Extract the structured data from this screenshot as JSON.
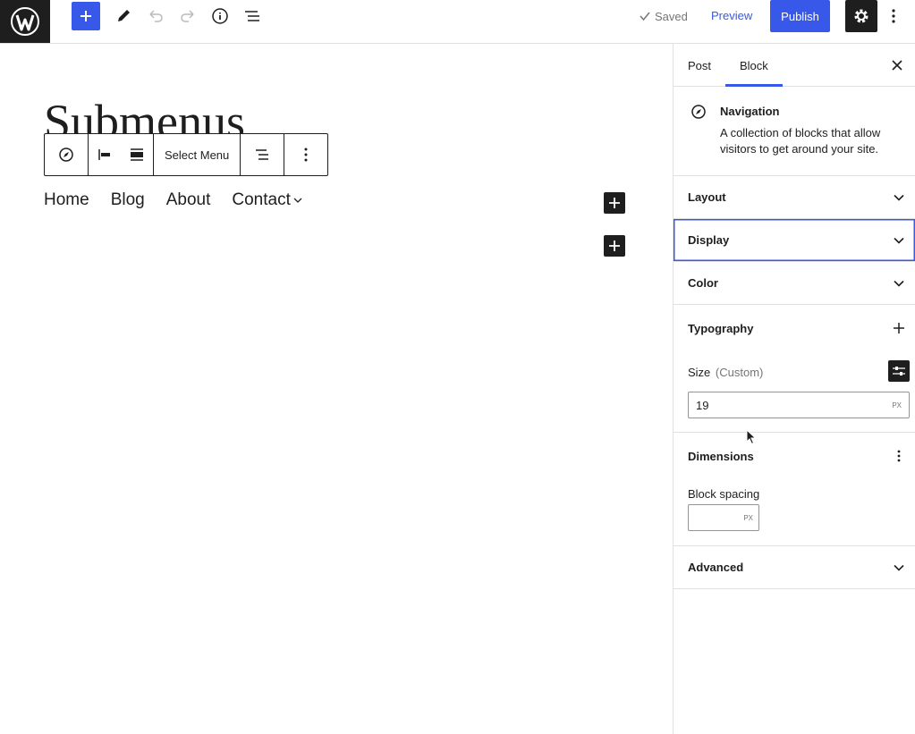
{
  "topbar": {
    "saved_label": "Saved",
    "preview_label": "Preview",
    "publish_label": "Publish",
    "accent_color": "#3858e9"
  },
  "canvas": {
    "post_title": "Submenus",
    "toolbar": {
      "select_menu_label": "Select Menu"
    },
    "navigation": {
      "items": [
        {
          "label": "Home"
        },
        {
          "label": "Blog"
        },
        {
          "label": "About"
        },
        {
          "label": "Contact"
        }
      ]
    }
  },
  "sidebar": {
    "tabs": [
      {
        "label": "Post"
      },
      {
        "label": "Block"
      }
    ],
    "block_card": {
      "title": "Navigation",
      "description": "A collection of blocks that allow visitors to get around your site."
    },
    "panels": {
      "layout": "Layout",
      "display": "Display",
      "color": "Color",
      "typography": "Typography",
      "dimensions": "Dimensions",
      "advanced": "Advanced"
    },
    "typography_size": {
      "label": "Size",
      "custom": "(Custom)",
      "value": "19",
      "unit": "PX"
    },
    "block_spacing": {
      "label": "Block spacing",
      "value": "",
      "unit": "PX"
    }
  }
}
